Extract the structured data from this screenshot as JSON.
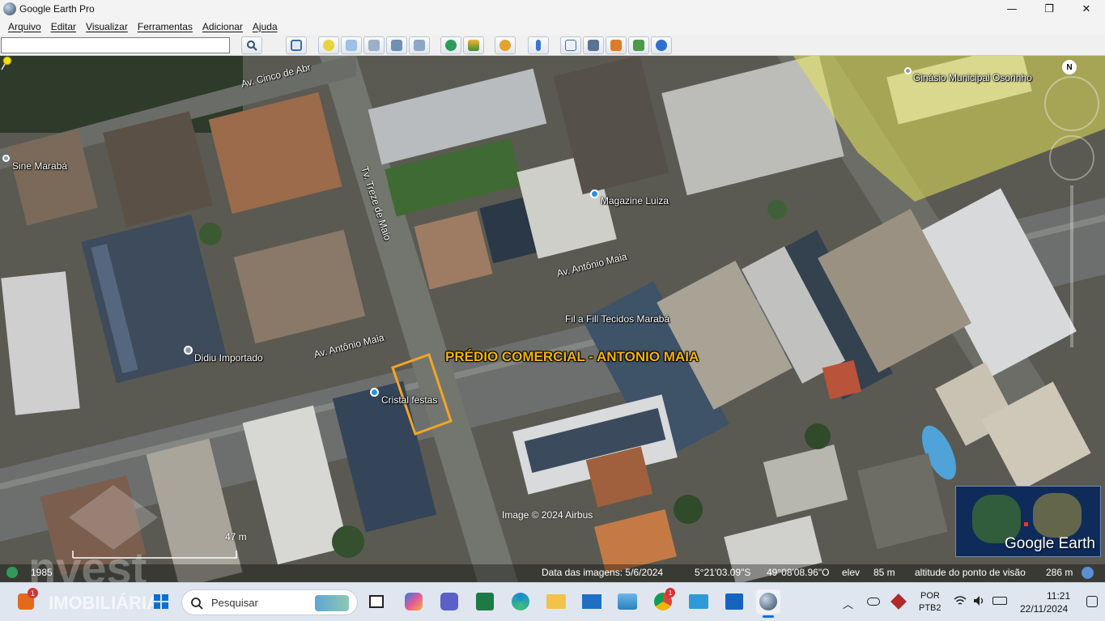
{
  "window": {
    "title": "Google Earth Pro",
    "minimize": "—",
    "maximize": "❐",
    "close": "✕"
  },
  "menu": [
    "Arquivo",
    "Editar",
    "Visualizar",
    "Ferramentas",
    "Adicionar",
    "Ajuda"
  ],
  "toolbar": {
    "search_value": ""
  },
  "map": {
    "placemark_title": "PRÉDIO COMERCIAL - ANTONIO MAIA",
    "pois": {
      "ginasio": "Ginásio Municipal Osorinho",
      "sine": "Sine Marabá",
      "magazine": "Magazine Luiza",
      "fila": "Fil a Fill Tecidos Marabá",
      "didiu": "Didiu Importado",
      "cristal": "Cristal festas"
    },
    "roads": {
      "av_cinco": "Av. Cinco de Abr",
      "tv_treze": "Tv. Treze de Maio",
      "av_antonio_1": "Av. Antônio Maia",
      "av_antonio_2": "Av. Antônio Maia"
    },
    "copyright": "Image © 2024 Airbus",
    "scale": "47 m",
    "compass": "N",
    "minimap_label": "Google Earth",
    "status": {
      "historical_year": "1985",
      "imagery_date": "Data das imagens: 5/6/2024",
      "lat": "5°21'03.09\"S",
      "lon": "49°08'08.96\"O",
      "elev_label": "elev",
      "elev_value": "85 m",
      "eye_alt_label": "altitude do ponto de visão",
      "eye_alt_value": "286 m"
    },
    "watermark": {
      "brand": "nvest",
      "sub": "IMOBILIÁRIA"
    }
  },
  "taskbar": {
    "search_placeholder": "Pesquisar",
    "notification_badge": "1",
    "chrome_badge": "1",
    "lang_top": "POR",
    "lang_bottom": "PTB2",
    "time": "11:21",
    "date": "22/11/2024"
  }
}
